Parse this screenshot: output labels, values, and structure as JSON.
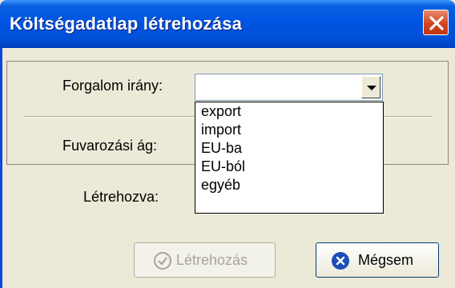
{
  "window": {
    "title": "Költségadatlap létrehozása"
  },
  "form": {
    "direction_label": "Forgalom irány:",
    "direction_value": "",
    "transport_label": "Fuvarozási ág:",
    "created_label": "Létrehozva:"
  },
  "dropdown": {
    "options": [
      "export",
      "import",
      "EU-ba",
      "EU-ból",
      "egyéb"
    ]
  },
  "buttons": {
    "create_label": "Létrehozás",
    "cancel_label": "Mégsem"
  },
  "icons": {
    "close": "close-icon",
    "create": "check-circle-icon",
    "cancel": "x-circle-icon"
  },
  "colors": {
    "titlebar": "#0054e3",
    "close": "#d2461f",
    "dialog_bg": "#ece9d8"
  }
}
